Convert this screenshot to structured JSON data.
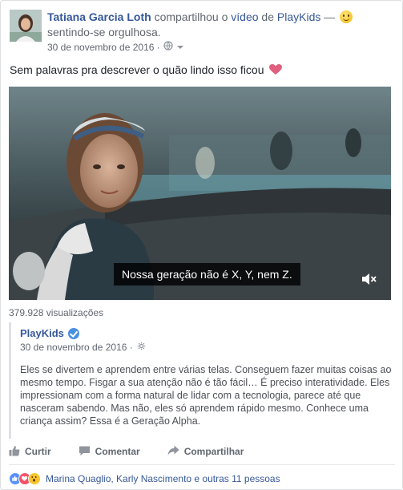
{
  "post": {
    "author": "Tatiana Garcia Loth",
    "shared_text": "compartilhou o",
    "video_link": "vídeo",
    "from_word": "de",
    "page_name": "PlayKids",
    "dash": "—",
    "feeling": "sentindo-se orgulhosa.",
    "date": "30 de novembro de 2016 ·",
    "text": "Sem palavras pra descrever o quão lindo isso ficou",
    "icons": [
      "avatar",
      "smiley-icon",
      "globe-icon",
      "chevron-down-icon",
      "heart-icon"
    ]
  },
  "video": {
    "caption": "Nossa geração não é X, Y, nem Z.",
    "views": "379.928 visualizações",
    "icons": [
      "mute-icon"
    ]
  },
  "shared": {
    "name": "PlayKids",
    "date": "30 de novembro de 2016 ·",
    "body": "Eles se divertem e aprendem entre várias telas. Conseguem fazer muitas coisas ao mesmo tempo. Fisgar a sua atenção não é tão fácil… É preciso interatividade. Eles impressionam com a forma natural de lidar com a tecnologia, parece até que nasceram sabendo. Mas não, eles só aprendem rápido mesmo. Conhece uma criança assim? Essa é a Geração Alpha.",
    "icons": [
      "verified-icon",
      "gear-icon"
    ]
  },
  "actions": {
    "like": "Curtir",
    "comment": "Comentar",
    "share": "Compartilhar"
  },
  "reactions": {
    "names": "Marina Quaglio, Karly Nascimento e outras 11 pessoas",
    "icons": [
      "like-reaction-icon",
      "love-reaction-icon",
      "wow-reaction-icon"
    ]
  },
  "colors": {
    "link": "#365899",
    "meta": "#616770",
    "like": "#5890ff",
    "love": "#f25268",
    "wow": "#f7c52b"
  }
}
